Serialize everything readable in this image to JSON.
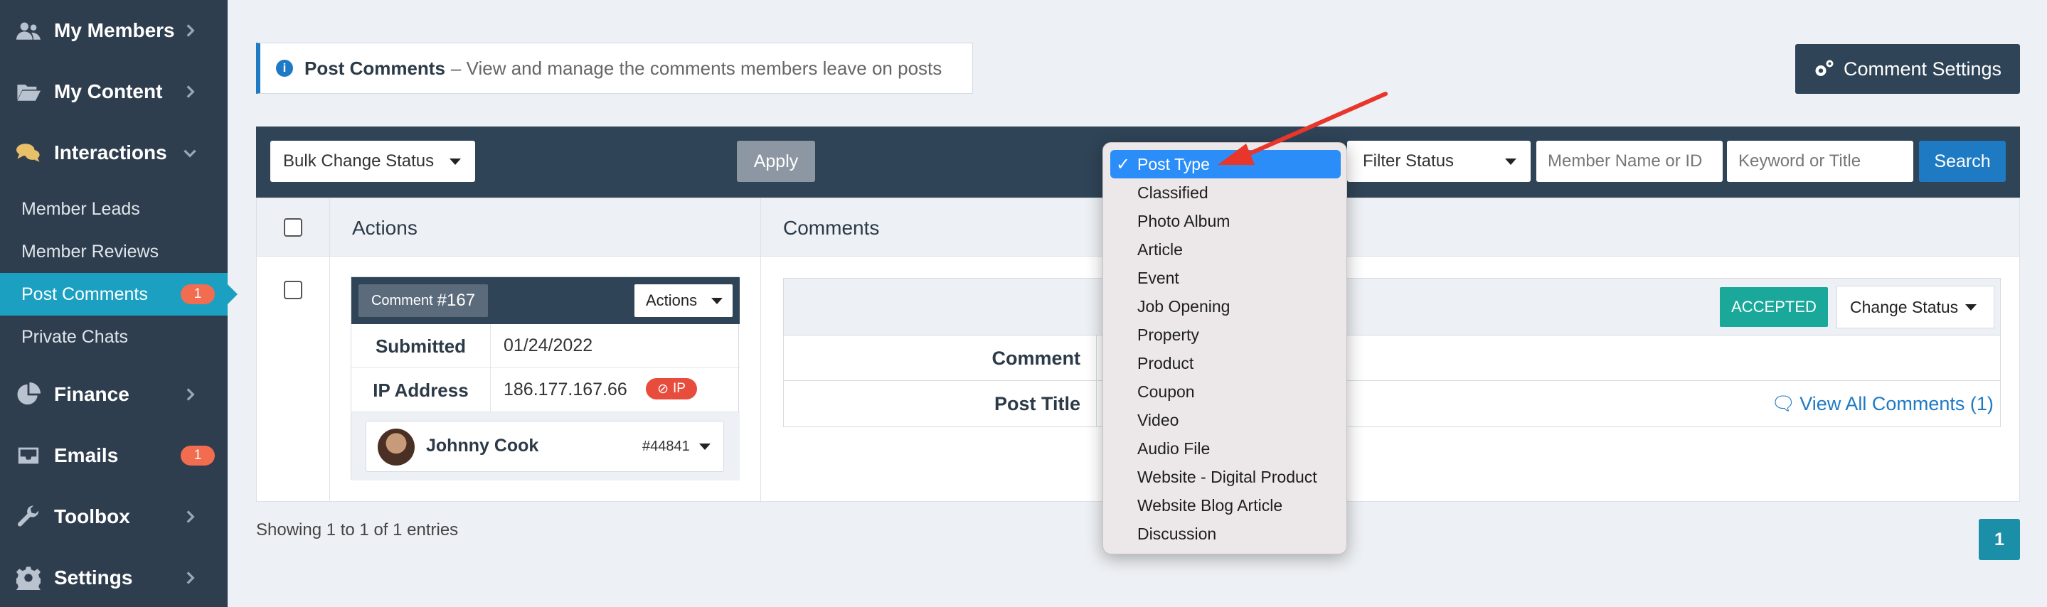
{
  "sidebar": {
    "items": [
      {
        "label": "My Members",
        "icon": "users-icon"
      },
      {
        "label": "My Content",
        "icon": "folder-open-icon"
      },
      {
        "label": "Interactions",
        "icon": "comments-icon"
      },
      {
        "label": "Finance",
        "icon": "pie-chart-icon"
      },
      {
        "label": "Emails",
        "icon": "inbox-icon",
        "badge": "1"
      },
      {
        "label": "Toolbox",
        "icon": "wrench-icon"
      },
      {
        "label": "Settings",
        "icon": "gear-icon"
      }
    ],
    "sub_items": [
      {
        "label": "Member Leads"
      },
      {
        "label": "Member Reviews"
      },
      {
        "label": "Post Comments",
        "badge": "1",
        "active": true
      },
      {
        "label": "Private Chats"
      }
    ]
  },
  "header": {
    "title": "Post Comments",
    "subtitle": "– View and manage the comments members leave on posts",
    "settings_button": "Comment Settings"
  },
  "toolbar": {
    "bulk_select": "Bulk Change Status",
    "apply_button": "Apply",
    "filter_status": "Filter Status",
    "member_placeholder": "Member Name or ID",
    "keyword_placeholder": "Keyword or Title",
    "search_button": "Search"
  },
  "table": {
    "headers": {
      "actions": "Actions",
      "comments": "Comments"
    },
    "row": {
      "comment_label": "Comment",
      "comment_number": "#167",
      "actions_button": "Actions",
      "submitted_label": "Submitted",
      "submitted_value": "01/24/2022",
      "ip_label": "IP Address",
      "ip_value": "186.177.167.66",
      "ip_badge": "IP",
      "member_name": "Johnny Cook",
      "member_id": "#44841",
      "status": "ACCEPTED",
      "change_status": "Change Status",
      "comment_key": "Comment",
      "post_title_key": "Post Title",
      "view_all": "View All Comments (1)"
    }
  },
  "footer": {
    "showing": "Showing 1 to 1 of 1 entries",
    "page": "1"
  },
  "dropdown": {
    "options": [
      "Post Type",
      "Classified",
      "Photo Album",
      "Article",
      "Event",
      "Job Opening",
      "Property",
      "Product",
      "Coupon",
      "Video",
      "Audio File",
      "Website - Digital Product",
      "Website Blog Article",
      "Discussion"
    ],
    "selected": "Post Type",
    "check": "✓"
  },
  "colors": {
    "sidebar_bg": "#2f3e4e",
    "accent_blue": "#1f7ac4",
    "active_item": "#1ba0c2",
    "badge": "#f26c4f",
    "accepted": "#1aa89a",
    "annotation_arrow": "#e8362a"
  }
}
